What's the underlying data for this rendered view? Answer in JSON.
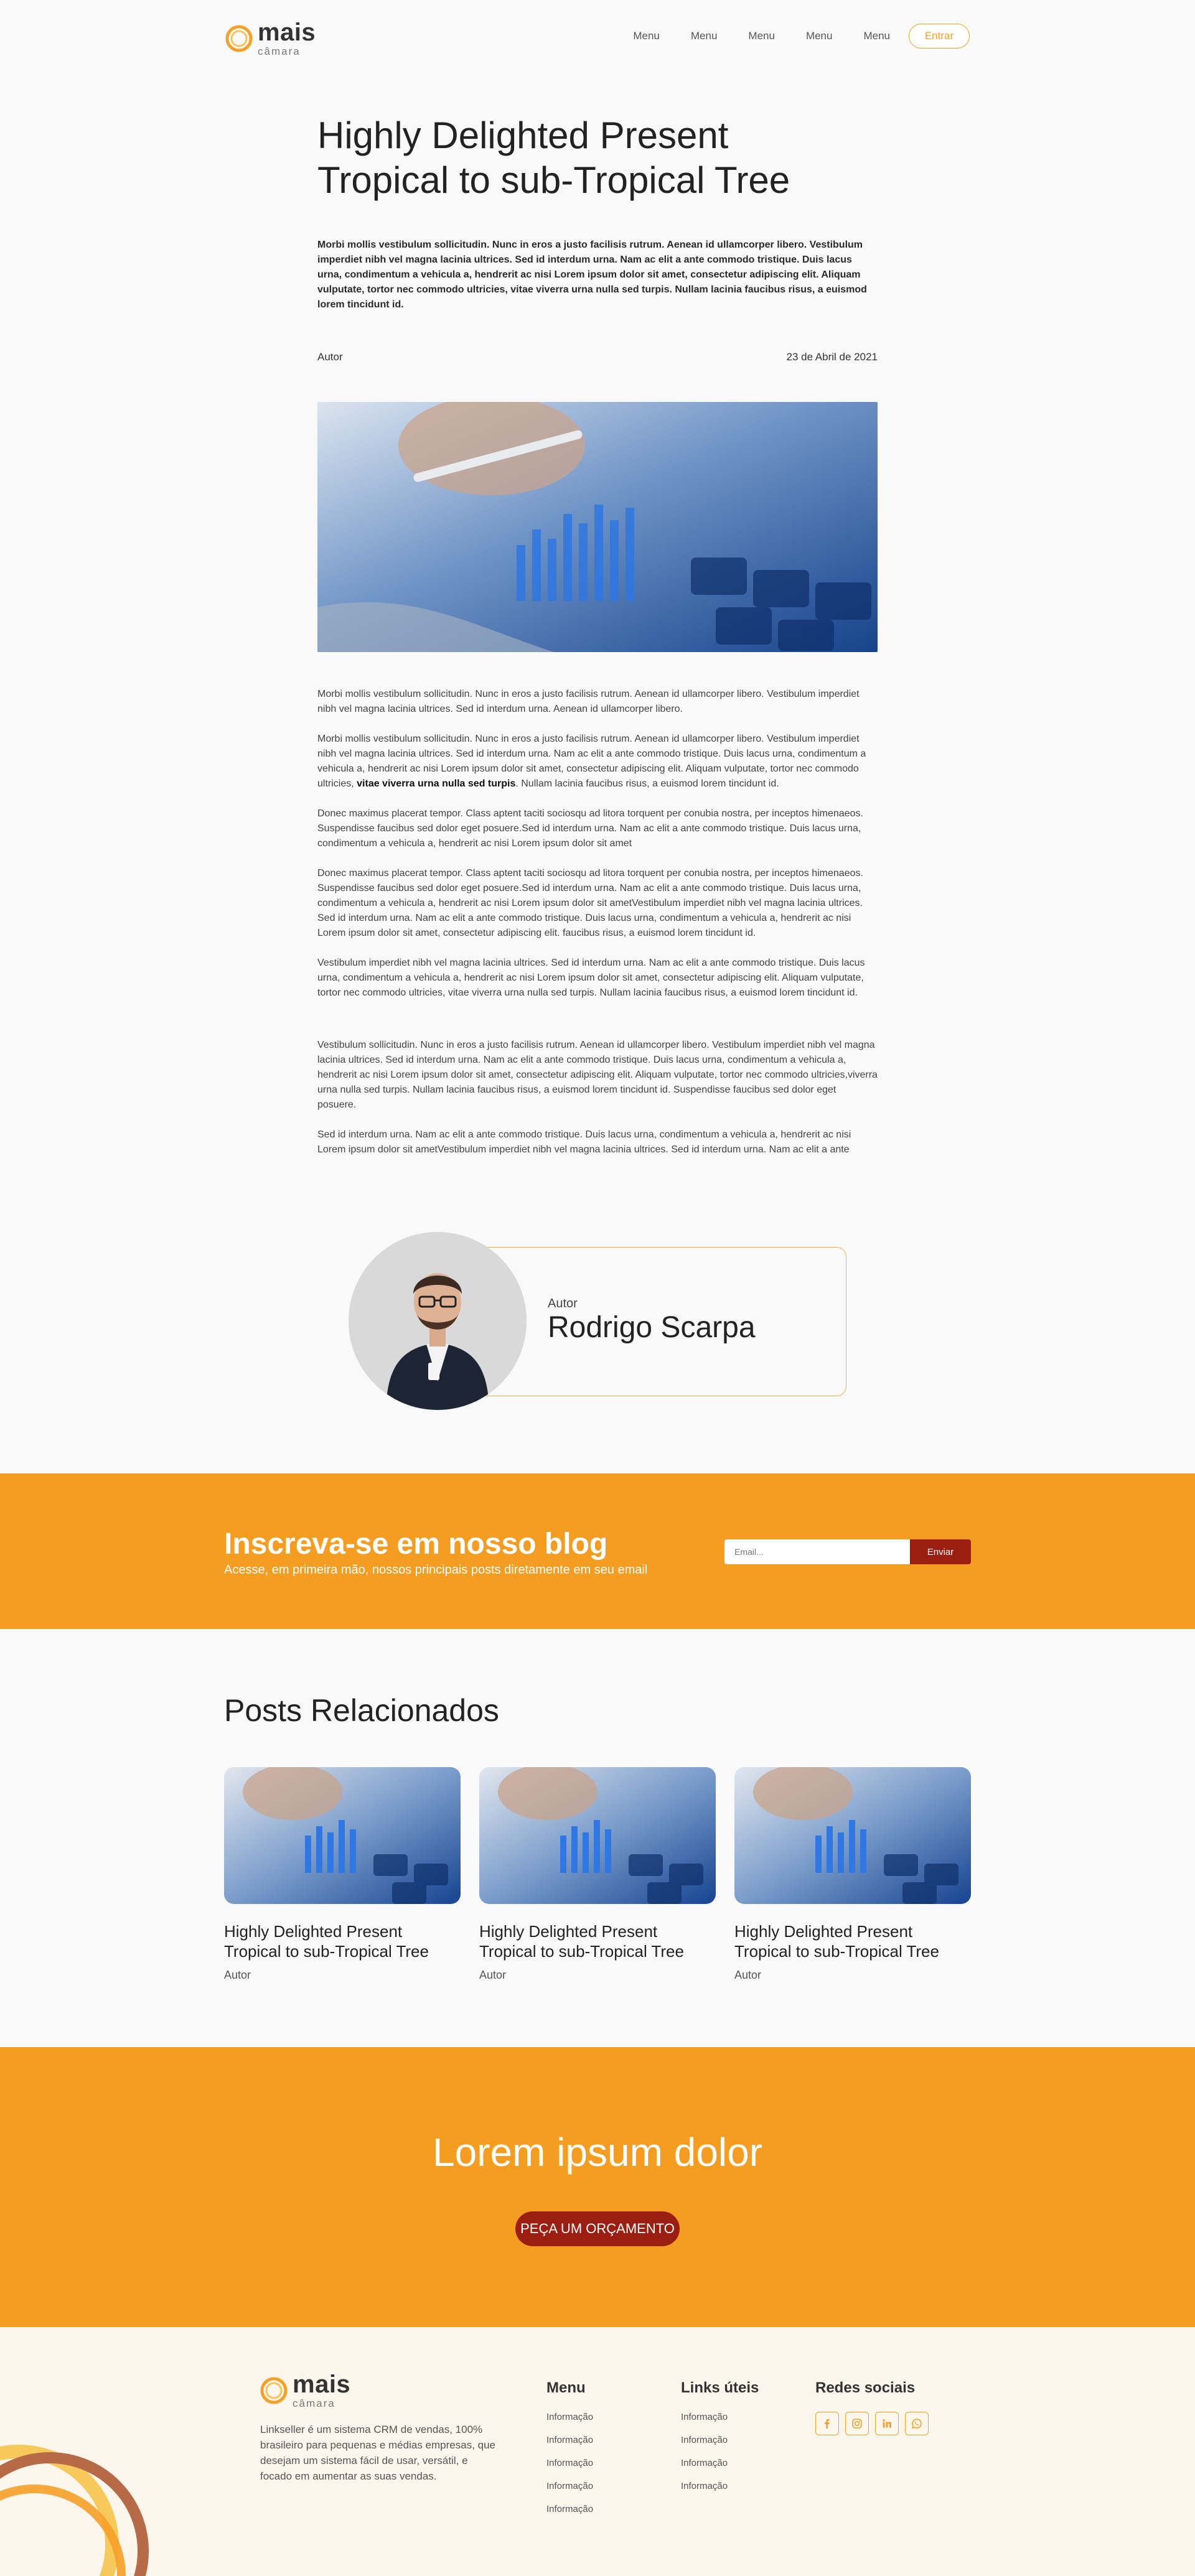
{
  "header": {
    "logo_main": "mais",
    "logo_sub": "câmara",
    "nav": [
      "Menu",
      "Menu",
      "Menu",
      "Menu",
      "Menu"
    ],
    "login_label": "Entrar"
  },
  "article": {
    "title": "Highly Delighted Present Tropical to sub-Tropical Tree",
    "lead": "Morbi mollis vestibulum sollicitudin. Nunc in eros a justo facilisis rutrum. Aenean id ullamcorper libero. Vestibulum imperdiet nibh vel magna lacinia ultrices. Sed id interdum urna. Nam ac elit a ante commodo tristique. Duis lacus urna, condimentum a vehicula a, hendrerit ac nisi Lorem ipsum dolor sit amet, consectetur adipiscing elit. Aliquam vulputate, tortor nec commodo ultricies, vitae viverra urna nulla sed turpis. Nullam lacinia faucibus risus, a euismod lorem tincidunt id.",
    "author_label": "Autor",
    "date": "23 de Abril de 2021",
    "paragraphs": [
      "Morbi mollis vestibulum sollicitudin. Nunc in eros a justo facilisis rutrum. Aenean id ullamcorper libero. Vestibulum imperdiet nibh vel magna lacinia ultrices. Sed id interdum urna.  Aenean id ullamcorper libero.",
      "Morbi mollis vestibulum sollicitudin. Nunc in eros a justo facilisis rutrum. Aenean id ullamcorper libero. Vestibulum imperdiet nibh vel magna lacinia ultrices. Sed id interdum urna. Nam ac elit a ante commodo tristique. Duis lacus urna, condimentum a vehicula a, hendrerit ac nisi Lorem ipsum dolor sit amet, consectetur adipiscing elit. Aliquam vulputate, tortor nec commodo ultricies,",
      "vitae viverra urna nulla sed turpis",
      ". Nullam lacinia faucibus risus, a euismod lorem tincidunt id.",
      "Donec maximus placerat tempor. Class aptent taciti sociosqu ad litora torquent per conubia nostra, per inceptos himenaeos. Suspendisse faucibus sed dolor eget posuere.Sed id interdum urna. Nam ac elit a ante commodo tristique. Duis lacus urna, condimentum a vehicula a, hendrerit ac nisi Lorem ipsum dolor sit amet",
      "Donec maximus placerat tempor. Class aptent taciti sociosqu ad litora torquent per conubia nostra, per inceptos himenaeos. Suspendisse faucibus sed dolor eget posuere.Sed id interdum urna. Nam ac elit a ante commodo tristique. Duis lacus urna, condimentum a vehicula a, hendrerit ac nisi Lorem ipsum dolor sit ametVestibulum imperdiet nibh vel magna lacinia ultrices. Sed id interdum urna. Nam ac elit a ante commodo tristique. Duis lacus urna, condimentum a vehicula a, hendrerit ac nisi Lorem ipsum dolor sit amet, consectetur adipiscing elit. faucibus risus, a euismod lorem tincidunt id.",
      "Vestibulum imperdiet nibh vel magna lacinia ultrices. Sed id interdum urna. Nam ac elit a ante commodo tristique. Duis lacus urna, condimentum a vehicula a, hendrerit ac nisi Lorem ipsum dolor sit amet, consectetur adipiscing elit. Aliquam vulputate, tortor nec commodo ultricies, vitae viverra urna nulla sed turpis. Nullam lacinia faucibus risus, a euismod lorem tincidunt id.",
      "Vestibulum sollicitudin. Nunc in eros a justo facilisis rutrum. Aenean id ullamcorper libero. Vestibulum imperdiet nibh vel magna lacinia ultrices. Sed id interdum urna. Nam ac elit a ante commodo tristique. Duis lacus urna, condimentum a vehicula a, hendrerit ac nisi Lorem ipsum dolor sit amet, consectetur adipiscing elit. Aliquam vulputate, tortor nec commodo ultricies,viverra urna nulla sed turpis. Nullam lacinia faucibus risus, a euismod lorem tincidunt id. Suspendisse faucibus sed dolor eget posuere.",
      "Sed id interdum urna. Nam ac elit a ante commodo tristique. Duis lacus urna, condimentum a vehicula a, hendrerit ac nisi Lorem ipsum dolor sit ametVestibulum imperdiet nibh vel magna lacinia ultrices. Sed id interdum urna. Nam ac elit a ante"
    ]
  },
  "author_card": {
    "label": "Autor",
    "name": "Rodrigo Scarpa"
  },
  "subscribe": {
    "title": "Inscreva-se em nosso blog",
    "text": "Acesse, em primeira mão, nossos principais posts diretamente em seu email",
    "placeholder": "Email...",
    "button": "Enviar"
  },
  "related": {
    "title": "Posts Relacionados",
    "posts": [
      {
        "title": "Highly Delighted Present Tropical to sub-Tropical Tree",
        "author": "Autor"
      },
      {
        "title": "Highly Delighted Present Tropical to sub-Tropical Tree",
        "author": "Autor"
      },
      {
        "title": "Highly Delighted Present Tropical to sub-Tropical Tree",
        "author": "Autor"
      }
    ]
  },
  "cta": {
    "title": "Lorem ipsum dolor",
    "button": "PEÇA UM ORÇAMENTO"
  },
  "footer": {
    "logo_main": "mais",
    "logo_sub": "câmara",
    "description": "Linkseller é um sistema CRM de vendas, 100% brasileiro para pequenas e médias empresas, que desejam um sistema fácil de usar, versátil, e focado em aumentar as suas vendas.",
    "menu_title": "Menu",
    "menu_items": [
      "Informação",
      "Informação",
      "Informação",
      "Informação",
      "Informação"
    ],
    "links_title": "Links úteis",
    "links_items": [
      "Informação",
      "Informação",
      "Informação",
      "Informação"
    ],
    "social_title": "Redes sociais",
    "socials": [
      "facebook-icon",
      "instagram-icon",
      "linkedin-icon",
      "whatsapp-icon"
    ]
  },
  "colors": {
    "accent": "#f59d21",
    "dark_red": "#9c1e10",
    "footer_bg": "#fdf6ec"
  }
}
